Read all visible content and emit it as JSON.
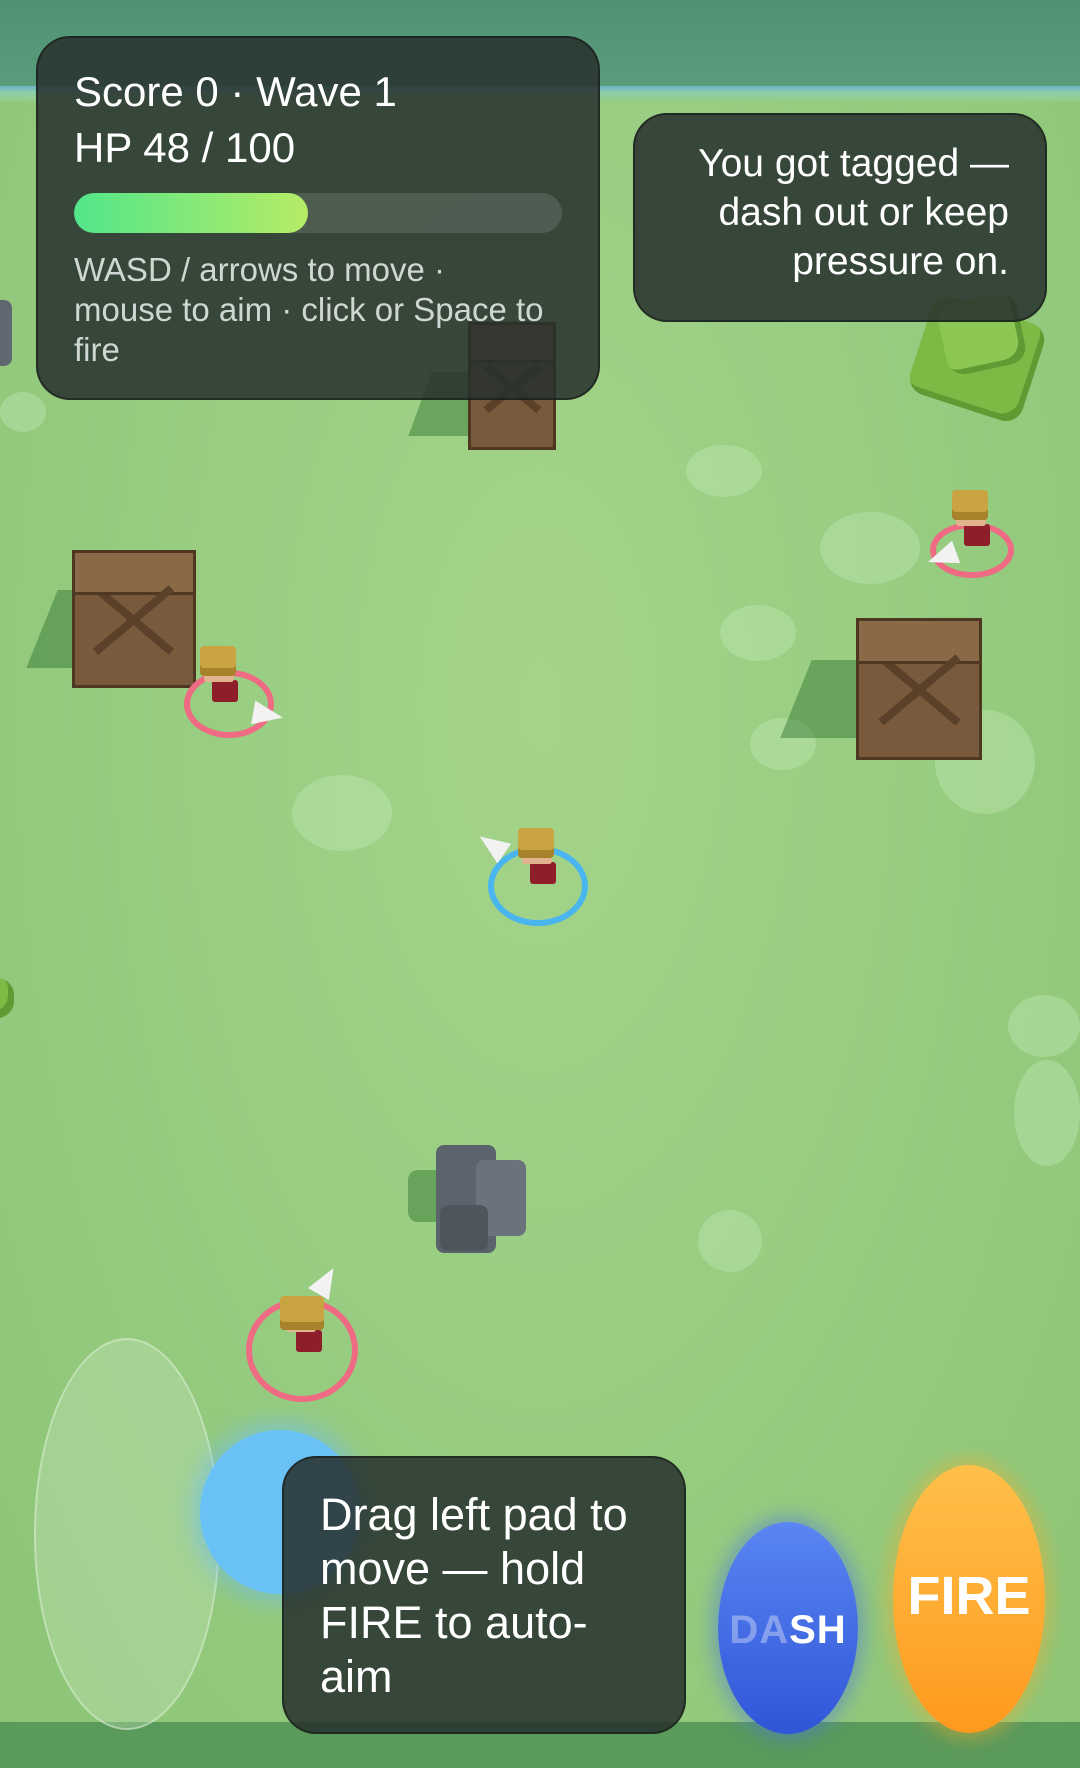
{
  "hud": {
    "score_line": "Score 0 · Wave 1",
    "hp_line": "HP 48 / 100",
    "hp": {
      "current": 48,
      "max": 100
    },
    "controls_hint": "WASD / arrows to move · mouse to aim · click or Space to fire"
  },
  "notice": {
    "text": "You got tagged — dash out or keep pressure on."
  },
  "touch_tip": {
    "text": "Drag left pad to move — hold FIRE to auto-aim"
  },
  "buttons": {
    "dash_label": "DASH",
    "fire_label": "FIRE"
  },
  "icons": {
    "move_pad": "joystick-pad",
    "player_marker": "player-ring",
    "enemy_marker": "enemy-ring"
  },
  "colors": {
    "ground": "#98cd82",
    "player_ring": "#49b6f0",
    "enemy_ring": "#ef6b83",
    "hp_fill_start": "#52e68a",
    "hp_fill_end": "#b6ec66",
    "dash_button": "#3f68e2",
    "fire_button": "#ffa82e"
  }
}
